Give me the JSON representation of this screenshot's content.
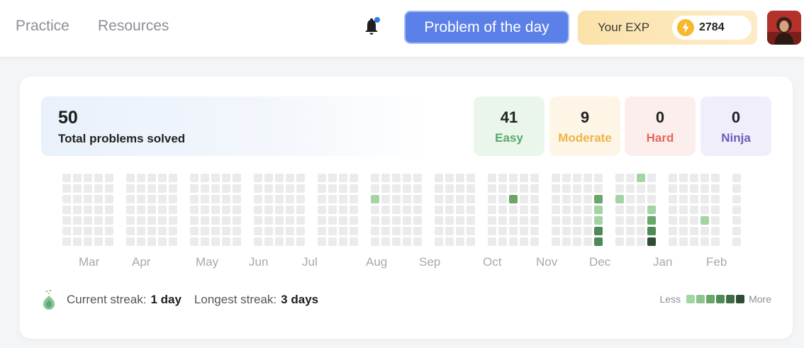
{
  "nav": {
    "practice": "Practice",
    "resources": "Resources"
  },
  "header": {
    "potd_label": "Problem of the day",
    "exp_label": "Your EXP",
    "exp_value": "2784",
    "notification_icon": "bell-icon",
    "exp_icon": "lightning-icon"
  },
  "stats": {
    "total": "50",
    "total_label": "Total problems solved",
    "difficulties": [
      {
        "count": "41",
        "label": "Easy",
        "color": "#5aa86a",
        "bg": "#eaf6ec"
      },
      {
        "count": "9",
        "label": "Moderate",
        "color": "#f0b445",
        "bg": "#fdf5e6"
      },
      {
        "count": "0",
        "label": "Hard",
        "color": "#e5685d",
        "bg": "#fdeeee"
      },
      {
        "count": "0",
        "label": "Ninja",
        "color": "#6d5bb8",
        "bg": "#f1eefb"
      }
    ]
  },
  "heatmap": {
    "months": [
      "Mar",
      "Apr",
      "May",
      "Jun",
      "Jul",
      "Aug",
      "Sep",
      "Oct",
      "Nov",
      "Dec",
      "Jan",
      "Feb"
    ],
    "empty_color": "#ebebeb",
    "levels": [
      "#a3d4a3",
      "#8fc48f",
      "#6aa56a",
      "#4e8a57",
      "#2f4d36"
    ]
  },
  "streak": {
    "icon": "flame-icon",
    "current_label": "Current streak:",
    "current_value": "1 day",
    "longest_label": "Longest streak:",
    "longest_value": "3 days"
  },
  "legend": {
    "less": "Less",
    "more": "More"
  }
}
